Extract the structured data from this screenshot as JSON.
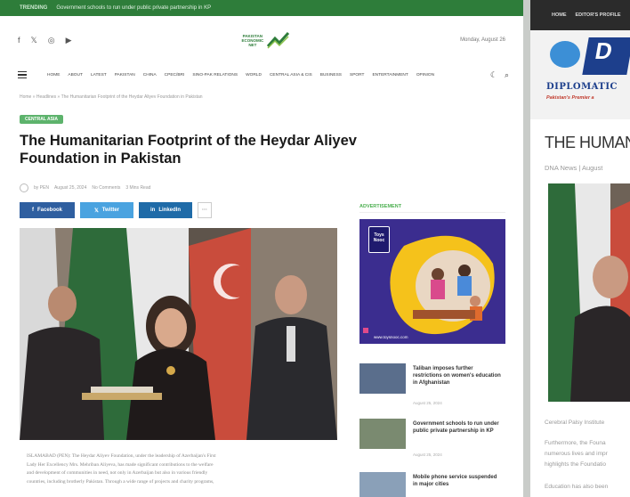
{
  "left_page": {
    "topbar": {
      "trending": "TRENDING",
      "ticker": "Government schools to run under public private partnership in KP"
    },
    "social_icons": [
      "facebook-icon",
      "x-icon",
      "instagram-icon",
      "youtube-icon"
    ],
    "logo": {
      "line1": "PAKISTAN",
      "line2": "ECONOMIC",
      "line3": "NET"
    },
    "date": "Monday, August 26",
    "nav": [
      "HOME",
      "ABOUT",
      "LATEST",
      "PAKISTAN",
      "CHINA",
      "CPEC/BRI",
      "SINO-PAK RELATIONS",
      "WORLD",
      "CENTRAL ASIA & CIS",
      "BUSINESS",
      "SPORT",
      "ENTERTAINMENT",
      "OPINION"
    ],
    "breadcrumb": "Home  »  Headlines  »  The Humanitarian Footprint of the Heydar Aliyev Foundation in Pakistan",
    "category": "CENTRAL ASIA",
    "title": "The Humanitarian Footprint of the Heydar Aliyev Foundation in Pakistan",
    "meta": {
      "author": "by PEN",
      "date": "August 25, 2024",
      "comments": "No Comments",
      "read_time": "3 Mins Read"
    },
    "share": {
      "facebook": "Facebook",
      "twitter": "Twitter",
      "linkedin": "LinkedIn",
      "more": "···"
    },
    "body_lines": [
      "ISLAMABAD (PEN): The Heydar Aliyev Foundation, under the leadership of Azerbaijan's First",
      "Lady Her Excellency Mrs. Mehriban Aliyeva, has made significant contributions to the welfare",
      "and development of communities in need, not only in Azerbaijan but also in various friendly",
      "countries, including brotherly Pakistan. Through a wide range of projects and charity programs,"
    ],
    "sidebar": {
      "ad_label": "ADVERTISEMENT",
      "ad_logo": "Toys Nooc",
      "ad_url": "www.toysnooc.com",
      "news": [
        {
          "headline": "Taliban imposes further restrictions on women's education in Afghanistan",
          "date": "August 25, 2024"
        },
        {
          "headline": "Government schools to run under public private partnership in KP",
          "date": "August 25, 2024"
        },
        {
          "headline": "Mobile phone service suspended in major cities",
          "date": ""
        }
      ]
    }
  },
  "right_page": {
    "topbar": [
      "HOME",
      "EDITOR'S PROFILE"
    ],
    "logo_letter": "D",
    "logo_text": "DIPLOMATIC",
    "tagline": "Pakistan's Premier a",
    "title": "THE HUMAN",
    "meta": "DNA News | August",
    "paragraphs": [
      "Cerebral Palsy Institute",
      "Furthermore, the Founa",
      "numerous lives and impr",
      "highlights the Foundatio",
      "Education has also been"
    ]
  },
  "colors": {
    "green": "#2e7d3a",
    "badge": "#5db36c",
    "facebook": "#2f5fa0",
    "twitter": "#4aa3e0",
    "linkedin": "#1f6ba8",
    "dna_blue": "#1d3f8c"
  }
}
